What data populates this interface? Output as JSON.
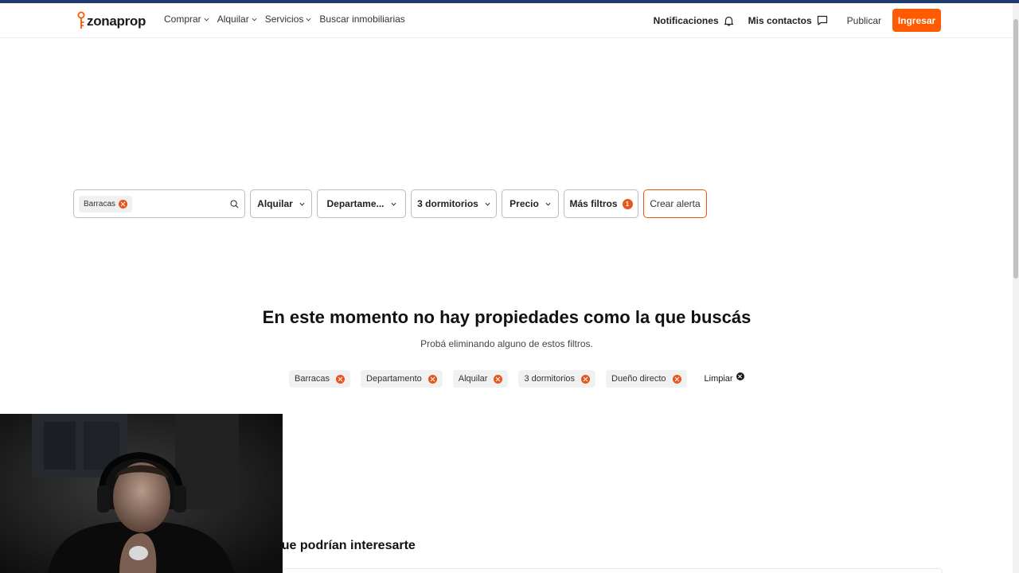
{
  "header": {
    "logo_text": "zonaprop",
    "nav": [
      {
        "label": "Comprar",
        "has_dropdown": true
      },
      {
        "label": "Alquilar",
        "has_dropdown": true
      },
      {
        "label": "Servicios",
        "has_dropdown": true
      },
      {
        "label": "Buscar inmobiliarias",
        "has_dropdown": false
      }
    ],
    "notifications_label": "Notificaciones",
    "contacts_label": "Mis contactos",
    "publish_label": "Publicar",
    "login_label": "Ingresar"
  },
  "filters": {
    "location_tag": "Barracas",
    "operation": "Alquilar",
    "property_type": "Departame...",
    "bedrooms": "3 dormitorios",
    "price": "Precio",
    "more_filters": "Más filtros",
    "more_filters_count": "1",
    "create_alert": "Crear alerta"
  },
  "empty_state": {
    "title": "En este momento no hay propiedades como la que buscás",
    "subtitle": "Probá eliminando alguno de estos filtros.",
    "chips": [
      "Barracas",
      "Departamento",
      "Alquilar",
      "3 dormitorios",
      "Dueño directo"
    ],
    "clear_label": "Limpiar"
  },
  "suggestions": {
    "title_visible": "que podrían interesarte"
  },
  "colors": {
    "brand_orange": "#ff5a00",
    "top_stripe": "#1e3a6e"
  },
  "icons": [
    "bell-icon",
    "chat-icon",
    "search-icon",
    "chevron-down-icon",
    "remove-chip-icon",
    "clear-icon"
  ]
}
